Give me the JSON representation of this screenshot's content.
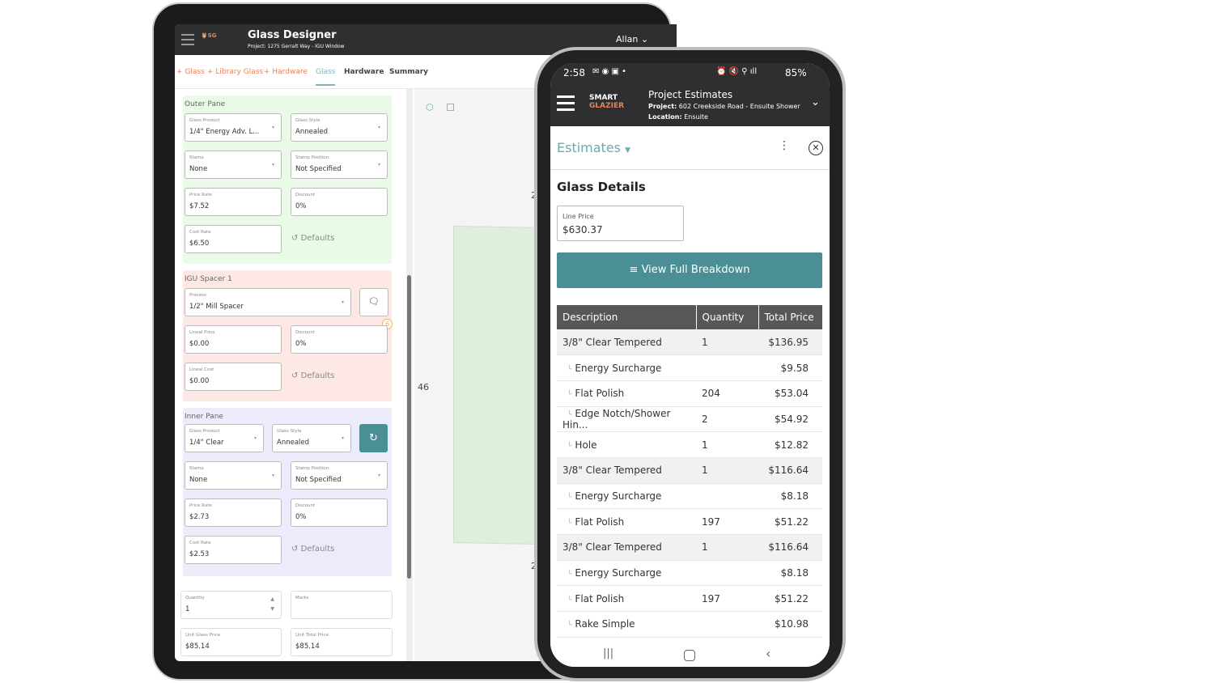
{
  "tablet": {
    "app_title": "Glass Designer",
    "project": "Project: 1275 Gerralt Way - IGU Window",
    "user": "Allan",
    "logo_text": "SMART GLAZIER",
    "tabs": [
      {
        "label": "+ Glass"
      },
      {
        "label": "+ Library Glass"
      },
      {
        "label": "+ Hardware"
      },
      {
        "label": "Glass",
        "active": true
      },
      {
        "label": "Hardware"
      },
      {
        "label": "Summary"
      }
    ],
    "outer": {
      "title": "Outer Pane",
      "glass_product_label": "Glass Product",
      "glass_product": "1/4\" Energy Adv. L...",
      "glass_style_label": "Glass Style",
      "glass_style": "Annealed",
      "stamp_label": "Stamp",
      "stamp": "None",
      "stamp_position_label": "Stamp Position",
      "stamp_position": "Not Specified",
      "price_rate_label": "Price Rate",
      "price_rate": "$7.52",
      "discount_label": "Discount",
      "discount": "0%",
      "cost_rate_label": "Cost Rate",
      "cost_rate": "$6.50",
      "defaults": "Defaults"
    },
    "spacer": {
      "title": "IGU Spacer 1",
      "process_label": "Process",
      "process": "1/2\" Mill Spacer",
      "badge": "6",
      "lineal_price_label": "Lineal Price",
      "lineal_price": "$0.00",
      "discount_label": "Discount",
      "discount": "0%",
      "lineal_cost_label": "Lineal Cost",
      "lineal_cost": "$0.00",
      "defaults": "Defaults"
    },
    "inner": {
      "title": "Inner Pane",
      "glass_product_label": "Glass Product",
      "glass_product": "1/4\" Clear",
      "glass_style_label": "Glass Style",
      "glass_style": "Annealed",
      "stamp_label": "Stamp",
      "stamp": "None",
      "stamp_position_label": "Stamp Position",
      "stamp_position": "Not Specified",
      "price_rate_label": "Price Rate",
      "price_rate": "$2.73",
      "discount_label": "Discount",
      "discount": "0%",
      "cost_rate_label": "Cost Rate",
      "cost_rate": "$2.53",
      "defaults": "Defaults"
    },
    "quantity_label": "Quantity",
    "quantity": "1",
    "marks_label": "Marks",
    "marks": "",
    "unit_glass_price_label": "Unit Glass Price",
    "unit_glass_price": "$85.14",
    "unit_total_price_label": "Unit Total Price",
    "unit_total_price": "$85.14",
    "canvas": {
      "dimension_height": "46",
      "dim_top": "2",
      "dim_bottom": "2"
    },
    "colors": {
      "outer": "#e9fbe6",
      "spacer": "#fde8e6",
      "inner": "#ecebfb",
      "accent": "#4a8f96",
      "add_link": "#e8825a"
    }
  },
  "phone": {
    "status": {
      "time": "2:58",
      "battery": "85%"
    },
    "header": {
      "title": "Project Estimates",
      "project_label": "Project:",
      "project": "602 Creekside Road - Ensuite Shower",
      "location_label": "Location:",
      "location": "Ensuite"
    },
    "estimates_label": "Estimates",
    "section_title": "Glass Details",
    "line_price_label": "Line Price",
    "line_price": "$630.37",
    "breakdown_button": "View Full Breakdown",
    "table": {
      "headers": [
        "Description",
        "Quantity",
        "Total Price"
      ],
      "rows": [
        {
          "desc": "3/8\" Clear Tempered",
          "qty": "1",
          "total": "$136.95",
          "main": true
        },
        {
          "desc": "Energy Surcharge",
          "qty": "",
          "total": "$9.58"
        },
        {
          "desc": "Flat Polish",
          "qty": "204",
          "total": "$53.04"
        },
        {
          "desc": "Edge Notch/Shower Hin...",
          "qty": "2",
          "total": "$54.92"
        },
        {
          "desc": "Hole",
          "qty": "1",
          "total": "$12.82"
        },
        {
          "desc": "3/8\" Clear Tempered",
          "qty": "1",
          "total": "$116.64",
          "main": true
        },
        {
          "desc": "Energy Surcharge",
          "qty": "",
          "total": "$8.18"
        },
        {
          "desc": "Flat Polish",
          "qty": "197",
          "total": "$51.22"
        },
        {
          "desc": "3/8\" Clear Tempered",
          "qty": "1",
          "total": "$116.64",
          "main": true
        },
        {
          "desc": "Energy Surcharge",
          "qty": "",
          "total": "$8.18"
        },
        {
          "desc": "Flat Polish",
          "qty": "197",
          "total": "$51.22"
        },
        {
          "desc": "Rake Simple",
          "qty": "",
          "total": "$10.98"
        }
      ]
    }
  }
}
